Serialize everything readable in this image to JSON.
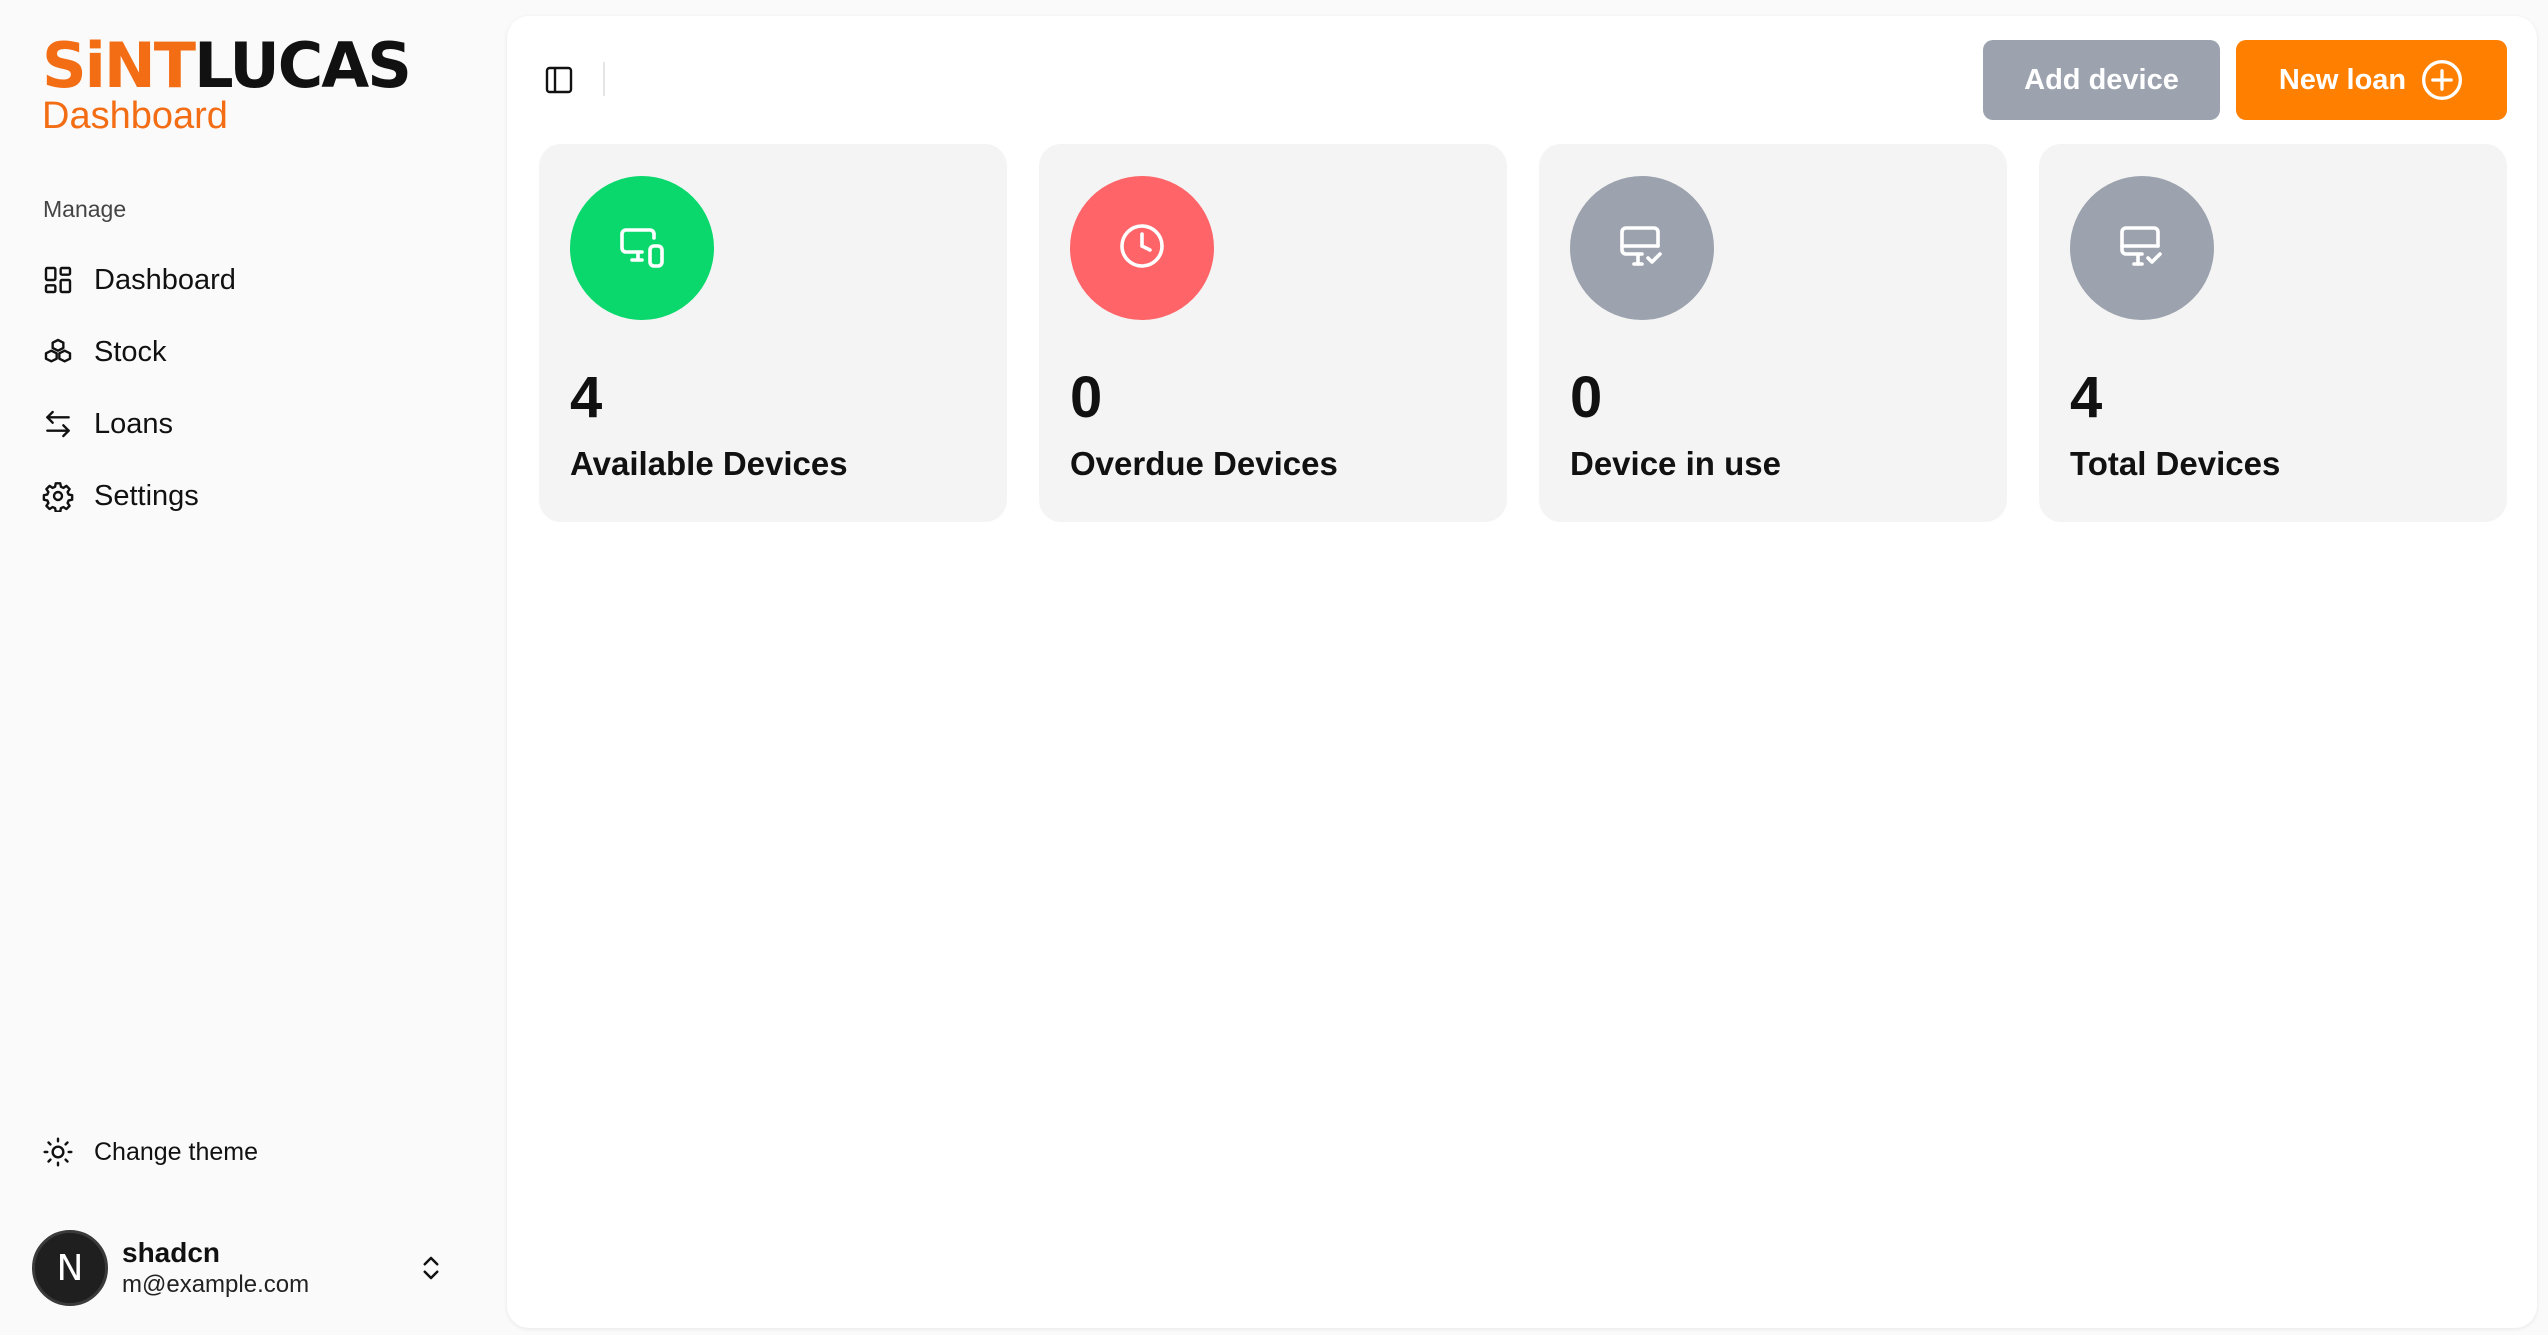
{
  "brand": {
    "logo_part1": "SiNT",
    "logo_part2": "LUCAS",
    "subtitle": "Dashboard"
  },
  "sidebar": {
    "group_label": "Manage",
    "items": [
      {
        "label": "Dashboard",
        "icon": "layout-dashboard-icon"
      },
      {
        "label": "Stock",
        "icon": "boxes-icon"
      },
      {
        "label": "Loans",
        "icon": "arrow-left-right-icon"
      },
      {
        "label": "Settings",
        "icon": "gear-icon"
      }
    ],
    "theme_label": "Change theme"
  },
  "user": {
    "initial": "N",
    "name": "shadcn",
    "email": "m@example.com"
  },
  "toolbar": {
    "add_device_label": "Add device",
    "new_loan_label": "New loan"
  },
  "stats": [
    {
      "value": "4",
      "label": "Available Devices",
      "color": "#0ad86c",
      "icon": "monitor-smartphone-icon"
    },
    {
      "value": "0",
      "label": "Overdue Devices",
      "color": "#ff6468",
      "icon": "clock-icon"
    },
    {
      "value": "0",
      "label": "Device in use",
      "color": "#9ca3af",
      "icon": "monitor-check-icon"
    },
    {
      "value": "4",
      "label": "Total Devices",
      "color": "#9ca3af",
      "icon": "monitor-check-icon"
    }
  ],
  "colors": {
    "accent": "#f36d15",
    "new_loan_button": "#ff8000",
    "add_device_button": "#9ca3af"
  }
}
